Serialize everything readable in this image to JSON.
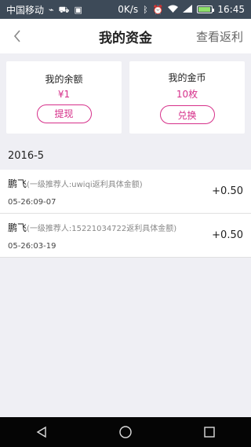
{
  "status_bar": {
    "carrier": "中国移动",
    "net_speed": "0K/s",
    "network": "4G",
    "time": "16:45"
  },
  "nav": {
    "title": "我的资金",
    "right_action": "查看返利",
    "back_icon": "chevron-left-icon"
  },
  "cards": [
    {
      "title": "我的余额",
      "value": "¥1",
      "button": "提现"
    },
    {
      "title": "我的金币",
      "value": "10枚",
      "button": "兑换"
    }
  ],
  "month_header": "2016-5",
  "records": [
    {
      "name": "鹏飞",
      "desc": "(一级推荐人:uwiqi返利具体金额)",
      "time": "05-26:09-07",
      "amount": "+0.50"
    },
    {
      "name": "鹏飞",
      "desc": "(一级推荐人:15221034722返利具体金额)",
      "time": "05-26:03-19",
      "amount": "+0.50"
    }
  ],
  "colors": {
    "accent": "#d6308a",
    "status_bar": "#3d4a58",
    "background": "#efeff4",
    "nav_bar_bottom": "#050505"
  },
  "bottom_nav": {
    "back": "triangle-back-icon",
    "home": "circle-home-icon",
    "recents": "square-recents-icon"
  }
}
